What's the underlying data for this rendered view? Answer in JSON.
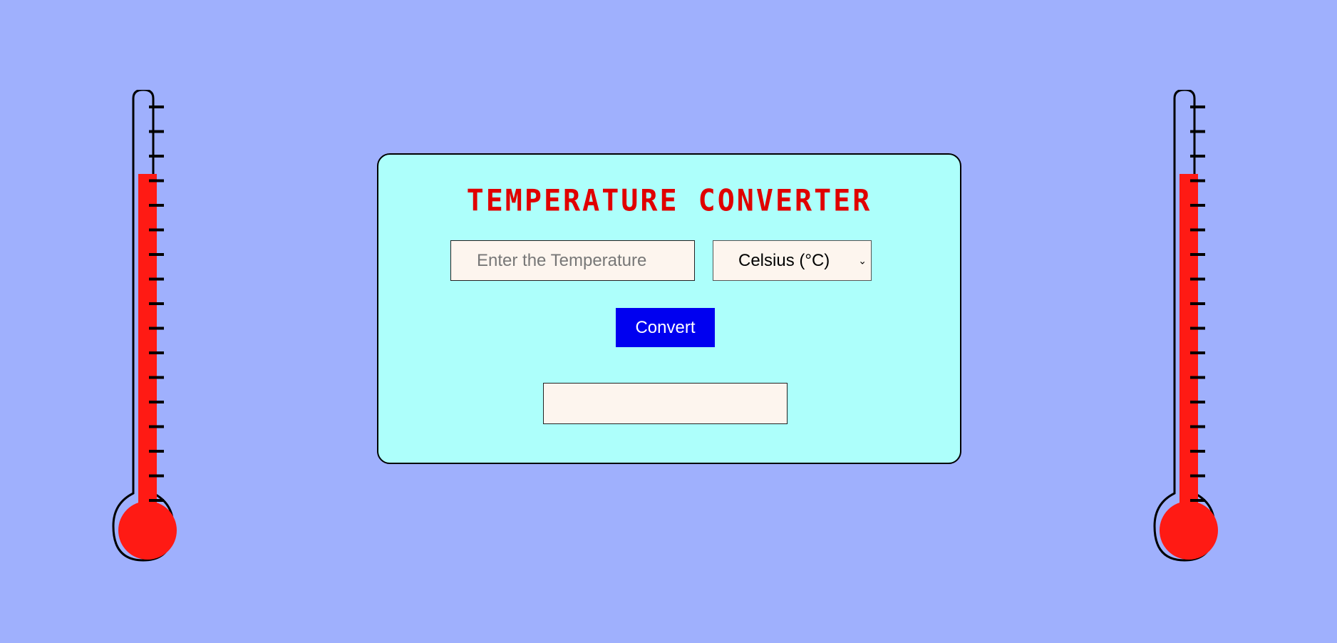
{
  "title": "TEMPERATURE CONVERTER",
  "input": {
    "placeholder": "Enter the Temperature",
    "value": ""
  },
  "unit_select": {
    "selected": "Celsius (°C)"
  },
  "convert_label": "Convert",
  "result": "",
  "colors": {
    "background": "#9fb0fd",
    "card": "#adfffb",
    "title": "#e00000",
    "button": "#0000f0",
    "mercury": "#ff1a14"
  },
  "icons": {
    "thermometer": "thermometer-icon",
    "dropdown": "chevron-down-icon"
  }
}
